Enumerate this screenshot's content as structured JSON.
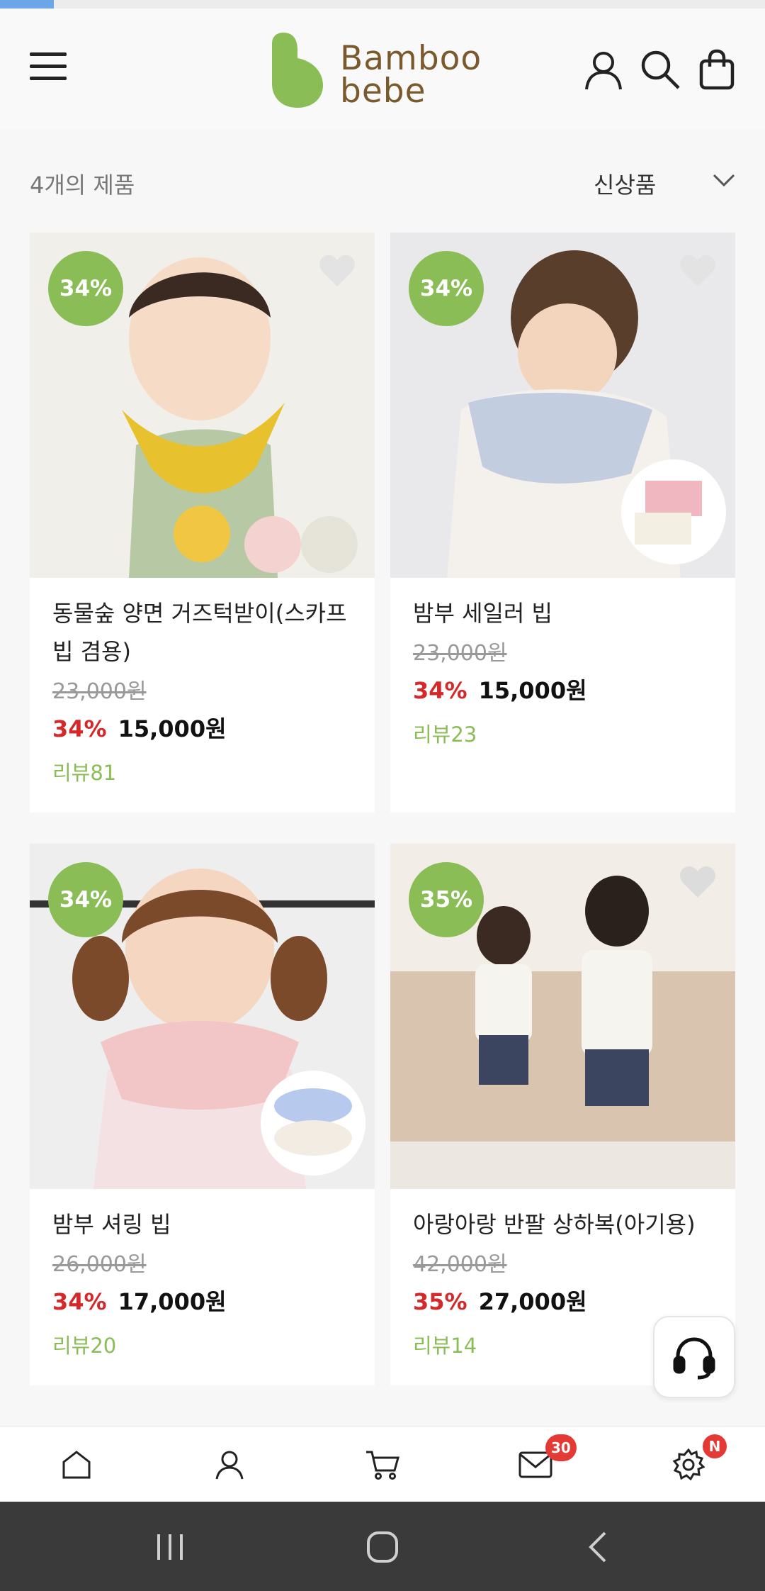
{
  "page_progress": 0.07,
  "brand": {
    "line1": "Bamboo",
    "line2": "bebe",
    "brand_color": "#7a5a2c",
    "mark_color": "#8bbd57"
  },
  "header": {
    "menu_icon": "hamburger-menu-icon",
    "account_icon": "user-icon",
    "search_icon": "search-icon",
    "cart_icon": "shopping-bag-icon"
  },
  "listing": {
    "count_label": "4개의 제품",
    "sort_label": "신상품"
  },
  "products": [
    {
      "badge": "34%",
      "name_line1": "동물숲 양면 거즈턱받이(스카프",
      "name_line2": "빕 겸용)",
      "original_price": "23,000원",
      "discount": "34%",
      "price": "15,000원",
      "review": "리뷰81"
    },
    {
      "badge": "34%",
      "name_line1": "밤부 세일러 빕",
      "name_line2": "",
      "original_price": "23,000원",
      "discount": "34%",
      "price": "15,000원",
      "review": "리뷰23"
    },
    {
      "badge": "34%",
      "name_line1": "밤부 셔링 빕",
      "name_line2": "",
      "original_price": "26,000원",
      "discount": "34%",
      "price": "17,000원",
      "review": "리뷰20"
    },
    {
      "badge": "35%",
      "name_line1": "아랑아랑 반팔 상하복(아기용)",
      "name_line2": "",
      "original_price": "42,000원",
      "discount": "35%",
      "price": "27,000원",
      "review": "리뷰14"
    }
  ],
  "bottom_nav": [
    {
      "icon": "home-icon"
    },
    {
      "icon": "user-icon"
    },
    {
      "icon": "cart-icon"
    },
    {
      "icon": "mail-icon",
      "badge": "30"
    },
    {
      "icon": "settings-icon",
      "badge": "N"
    }
  ],
  "fab": {
    "icon": "headset-icon"
  },
  "colors": {
    "accent_green": "#8bbd57",
    "discount_red": "#d62828",
    "badge_red": "#e53935"
  }
}
